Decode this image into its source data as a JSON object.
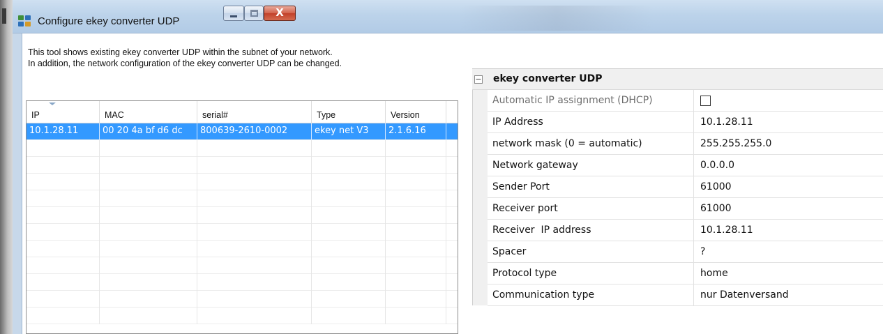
{
  "window": {
    "title": "Configure ekey converter UDP",
    "close_glyph": "X"
  },
  "description": {
    "line1": "This tool shows existing ekey converter UDP within the subnet of your network.",
    "line2": "In addition, the network configuration of the ekey converter UDP can be changed."
  },
  "device_list": {
    "columns": [
      "IP",
      "MAC",
      "serial#",
      "Type",
      "Version"
    ],
    "rows": [
      {
        "ip": "10.1.28.11",
        "mac": "00 20 4a bf d6 dc",
        "serial": "800639-2610-0002",
        "type": "ekey net V3",
        "version": "2.1.6.16",
        "selected": true
      }
    ]
  },
  "properties": {
    "category": "ekey converter UDP",
    "expand_glyph": "−",
    "items": [
      {
        "name": "Automatic IP assignment (DHCP)",
        "value": "",
        "checkbox": true,
        "checked": false
      },
      {
        "name": "IP Address",
        "value": "10.1.28.11"
      },
      {
        "name": "network mask (0 = automatic)",
        "value": "255.255.255.0"
      },
      {
        "name": "Network gateway",
        "value": "0.0.0.0"
      },
      {
        "name": "Sender Port",
        "value": "61000"
      },
      {
        "name": "Receiver port",
        "value": "61000"
      },
      {
        "name": "Receiver  IP address",
        "value": "10.1.28.11"
      },
      {
        "name": "Spacer",
        "value": "?"
      },
      {
        "name": "Protocol type",
        "value": "home"
      },
      {
        "name": "Communication type",
        "value": "nur Datenversand"
      }
    ]
  },
  "colors": {
    "selection": "#3399ff",
    "titlebar": "#bcd3ea",
    "close_button": "#c2412a"
  }
}
